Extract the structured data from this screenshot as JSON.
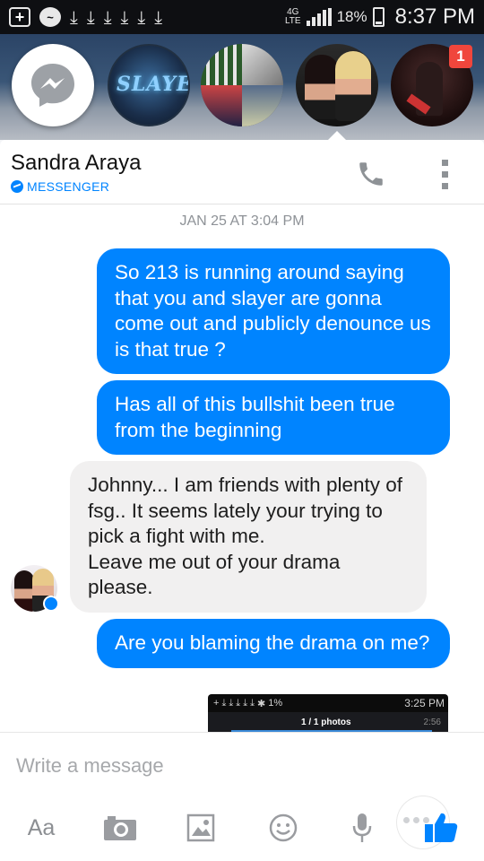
{
  "status_bar": {
    "network": "4G\nLTE",
    "battery": "18%",
    "time": "8:37 PM"
  },
  "chat_heads": {
    "notification_count": "1",
    "slayer_logo": "SLAYER"
  },
  "conversation": {
    "contact_name": "Sandra Araya",
    "source_label": "MESSENGER",
    "timestamp": "JAN 25 AT 3:04 PM",
    "messages": [
      {
        "direction": "outgoing",
        "text": "So 213 is running around saying that you and slayer are gonna come out and publicly denounce us is that true ?"
      },
      {
        "direction": "outgoing",
        "text": "Has all of this bullshit been true from the beginning"
      },
      {
        "direction": "incoming",
        "text": "Johnny... I am friends with plenty of fsg.. It seems lately your trying to pick a fight with me.\nLeave me out of your drama please."
      },
      {
        "direction": "outgoing",
        "text": "Are you blaming the drama on me?"
      }
    ],
    "attachment": {
      "status_time": "3:25 PM",
      "status_battery": "1%",
      "photo_counter": "1 / 1 photos",
      "sub_time": "2:56"
    }
  },
  "composer": {
    "placeholder": "Write a message",
    "aa_label": "Aa"
  },
  "colors": {
    "accent": "#0084ff",
    "incoming_bubble": "#f1f0f0",
    "notification": "#f0463c"
  }
}
